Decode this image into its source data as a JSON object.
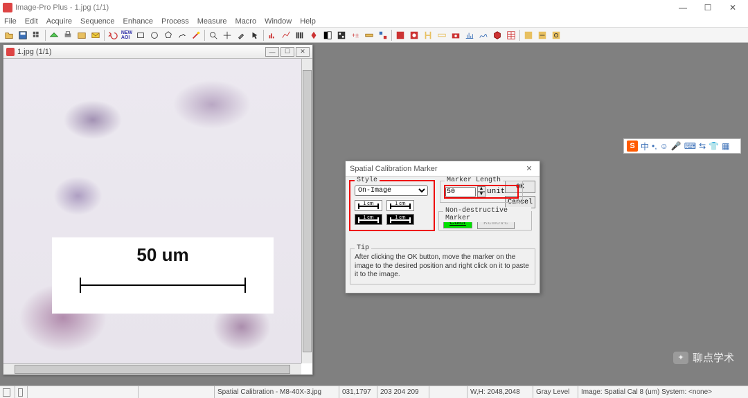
{
  "app": {
    "title": "Image-Pro Plus - 1.jpg (1/1)"
  },
  "menu": [
    "File",
    "Edit",
    "Acquire",
    "Sequence",
    "Enhance",
    "Process",
    "Measure",
    "Macro",
    "Window",
    "Help"
  ],
  "imgwin": {
    "title": "1.jpg (1/1)",
    "scale_label": "50 um"
  },
  "dialog": {
    "title": "Spatial Calibration Marker",
    "style_label": "Style",
    "style_value": "On-Image",
    "swatch_text": "1 cm",
    "marker_label": "Marker Length",
    "marker_value": "50",
    "marker_unit": "unit",
    "ndm_label": "Non-destructive Marker",
    "color_btn": "Color",
    "remove_btn": "Remove",
    "tip_label": "Tip",
    "tip_text": "After clicking the OK button, move the marker on the image to the desired position and right click on it to paste it to the image.",
    "ok": "OK",
    "cancel": "Cancel"
  },
  "ime": {
    "lang": "中",
    "sep": "•,",
    "icons": [
      "☺",
      "🎤",
      "⌨",
      "⇆",
      "👕",
      "▦"
    ]
  },
  "watermark": "聊点学术",
  "status": {
    "doc": "Spatial Calibration - M8-40X-3.jpg",
    "coords": "031,1797",
    "rgb": "203 204 209",
    "wh": "W,H: 2048,2048",
    "gray": "Gray Level",
    "cal": "Image: Spatial Cal 8 (um) System: <none>"
  }
}
